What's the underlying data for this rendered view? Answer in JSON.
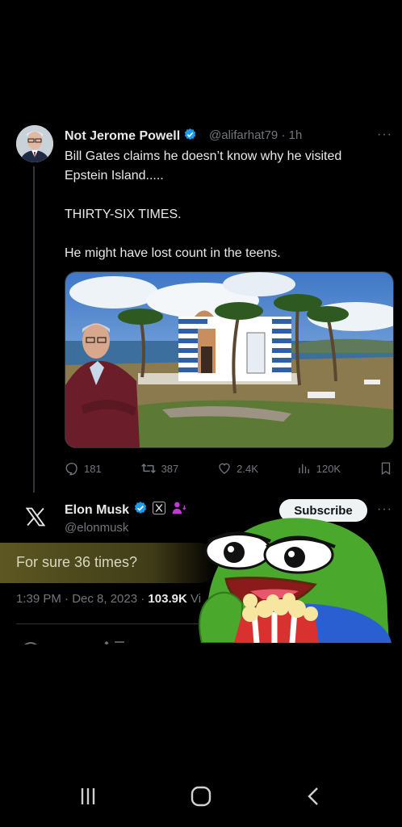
{
  "tweet": {
    "author_name": "Not Jerome Powell",
    "handle_time": "@alifarhat79 · 1h",
    "text_lines": [
      "Bill Gates claims he doesn’t know why he visited Epstein Island.....",
      "THIRTY-SIX TIMES.",
      "He might have lost count in the teens."
    ],
    "more_label": "···",
    "stats": {
      "replies": "181",
      "reposts": "387",
      "likes": "2.4K",
      "views": "120K"
    }
  },
  "reply": {
    "author_name": "Elon Musk",
    "handle": "@elonmusk",
    "subscribe_label": "Subscribe",
    "more_label": "···",
    "text": "For sure 36 times?",
    "time_date": "1:39 PM · Dec 8, 2023 · ",
    "views": "103.9K",
    "views_suffix": " Vi"
  },
  "colors": {
    "background": "#000000",
    "verified_blue": "#1d9bf0",
    "muted_text": "#71767b",
    "highlight": "#625c24",
    "pepe_green": "#4aa82c"
  },
  "icons": [
    "reply-icon",
    "repost-icon",
    "like-icon",
    "views-icon",
    "bookmark-icon",
    "verified-badge-icon",
    "x-logo-icon",
    "recent-apps-icon",
    "home-icon",
    "back-icon"
  ]
}
